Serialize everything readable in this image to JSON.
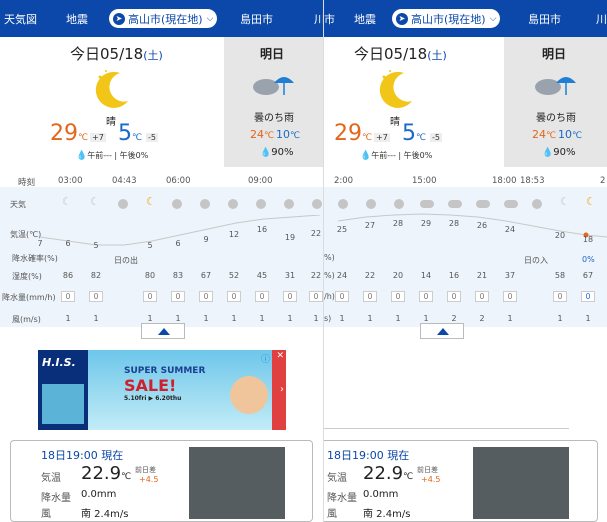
{
  "nav": {
    "left_items": [
      "天気図",
      "地震",
      "島田市",
      "川"
    ],
    "right_items": [
      "市",
      "地震",
      "島田市",
      "川"
    ],
    "location": "高山市(現在地)"
  },
  "today": {
    "title": "今日05/18",
    "dow": "(土)",
    "weather": "晴",
    "high": "29",
    "high_diff": "+7",
    "low": "5",
    "low_diff": "-5",
    "unit": "℃",
    "precip": "午前---",
    "precip_pm": "午後0%"
  },
  "tomorrow": {
    "title": "明日",
    "weather": "曇のち雨",
    "high": "24",
    "low": "10",
    "unit": "℃",
    "precip": "90%"
  },
  "hourly_left": {
    "times": [
      "時刻",
      "03:00",
      "04:43",
      "06:00",
      "09:00"
    ],
    "labels": {
      "weather": "天気",
      "temp": "気温(℃)",
      "rain_prob": "降水確率(%)",
      "humidity": "湿度(%)",
      "rain_amt": "降水量(mm/h)",
      "wind": "風(m/s)"
    },
    "temps": [
      "7",
      "6",
      "5",
      "5",
      "6",
      "9",
      "12",
      "16",
      "19",
      "22"
    ],
    "sunrise": "日の出",
    "humidity": [
      "86",
      "82",
      "80",
      "83",
      "67",
      "52",
      "45",
      "31",
      "22"
    ],
    "rain": [
      "0",
      "0",
      "0",
      "0",
      "0",
      "0",
      "0",
      "0",
      "0"
    ],
    "wind": [
      "1",
      "1",
      "1",
      "1",
      "1",
      "1",
      "1",
      "1",
      "1"
    ]
  },
  "hourly_right": {
    "times": [
      "2:00",
      "15:00",
      "18:00",
      "18:53",
      "2"
    ],
    "temps": [
      "25",
      "27",
      "28",
      "29",
      "28",
      "26",
      "24",
      "20",
      "18"
    ],
    "sunset": "日の入",
    "humidity": [
      "24",
      "22",
      "20",
      "14",
      "16",
      "21",
      "37",
      "58",
      "67"
    ],
    "rain": [
      "0",
      "0",
      "0",
      "0",
      "0",
      "0",
      "0",
      "0",
      "0"
    ],
    "wind": [
      "1",
      "1",
      "1",
      "1",
      "2",
      "2",
      "1",
      "1",
      "1"
    ],
    "prob_pct": "0%",
    "prob_pct2": "0%",
    "unit_pct": "%)",
    "unit_pct2": "%)",
    "unit_mm": "/h)",
    "unit_ms": "s)"
  },
  "ad": {
    "brand": "H.I.S.",
    "line1": "SUPER SUMMER",
    "line2": "SALE!",
    "dates": "5.10fri ▶ 6.20thu"
  },
  "obs": {
    "title": "18日19:00 現在",
    "temp_label": "気温",
    "temp_value": "22.9",
    "temp_unit": "℃",
    "diff_label": "前日差",
    "diff_value": "+4.5",
    "rain_label": "降水量",
    "rain_value": "0.0mm",
    "wind_label": "風",
    "wind_value": "南 2.4m/s"
  },
  "colors": {
    "nav": "#0b48a9",
    "high": "#e3661a",
    "low": "#1a68c7"
  }
}
